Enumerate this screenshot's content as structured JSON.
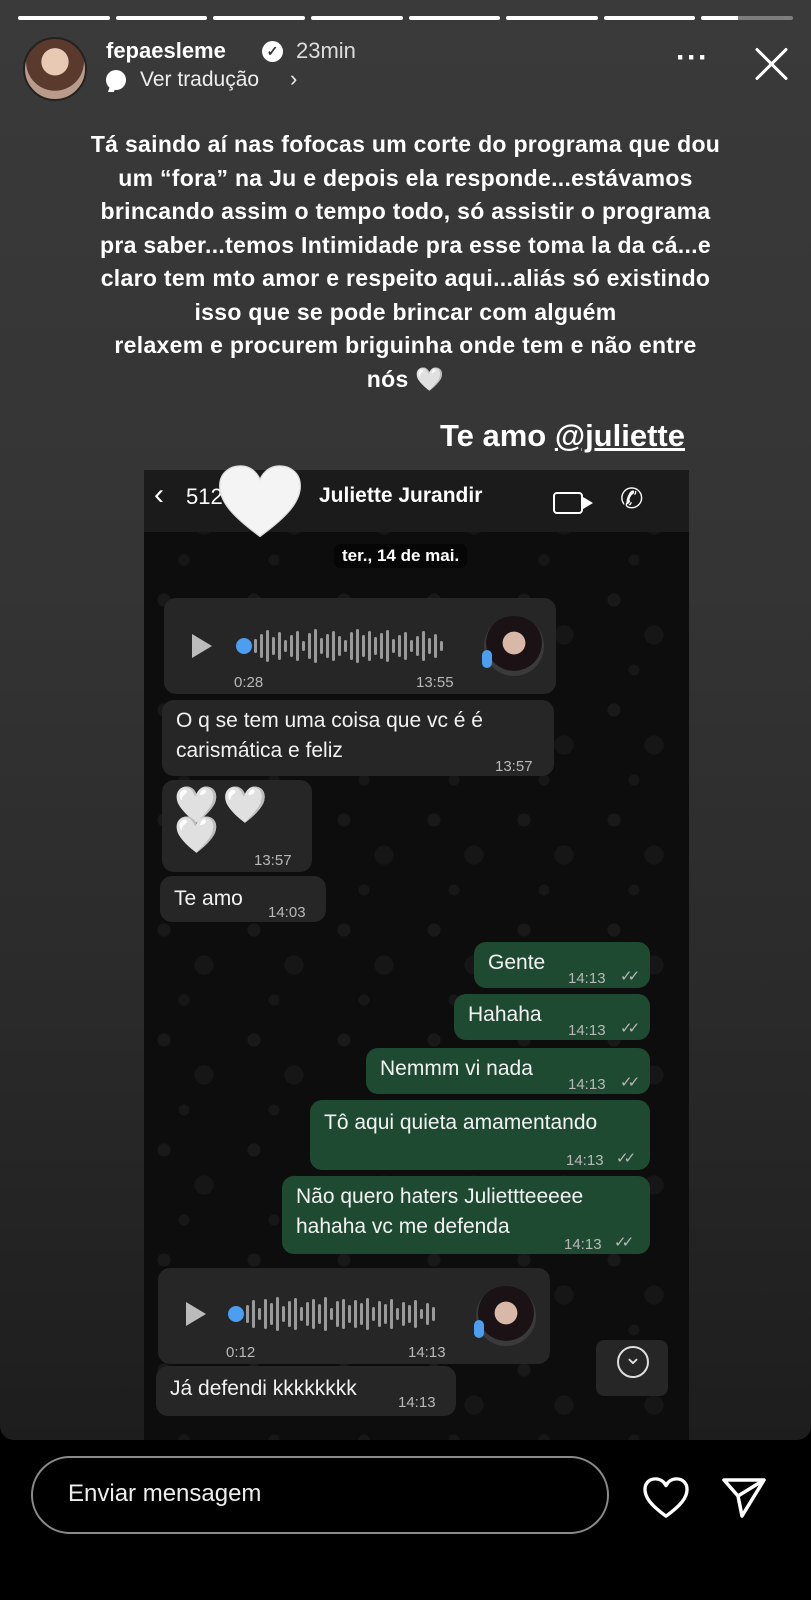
{
  "story": {
    "progress": [
      1,
      1,
      1,
      1,
      1,
      1,
      1,
      0.4
    ],
    "username": "fepaesleme",
    "time_ago": "23min",
    "translate_label": "Ver tradução",
    "caption_lines": [
      "Tá saindo aí nas fofocas um corte do programa que dou",
      "um “fora” na Ju e depois ela responde...estávamos",
      "brincando assim o tempo todo, só assistir o programa",
      "pra saber...temos Intimidade pra esse toma la da cá...e",
      "claro tem mto amor e respeito aqui...aliás só existindo",
      "isso que se pode brincar com alguém",
      "relaxem e procurem briguinha onde tem e não entre",
      "nós 🤍"
    ],
    "sticker_prefix": "Te amo ",
    "sticker_mention": "@juliette"
  },
  "chat": {
    "back_count": "512",
    "contact_name": "Juliette Jurandir",
    "date_chip": "ter., 14 de mai.",
    "voice1": {
      "duration": "0:28",
      "time": "13:55"
    },
    "msg1": {
      "text_lines": [
        "O q se tem uma coisa que vc é é",
        "carismática e feliz"
      ],
      "time": "13:57"
    },
    "msg2": {
      "text": "🤍🤍🤍",
      "time": "13:57"
    },
    "msg3": {
      "text": "Te amo",
      "time": "14:03"
    },
    "out": [
      {
        "text": "Gente",
        "time": "14:13"
      },
      {
        "text": "Hahaha",
        "time": "14:13"
      },
      {
        "text": "Nemmm vi nada",
        "time": "14:13"
      },
      {
        "text": "Tô aqui quieta amamentando",
        "time": "14:13"
      },
      {
        "text_lines": [
          "Não quero haters Juliettteeeee",
          "hahaha vc me defenda"
        ],
        "time": "14:13"
      }
    ],
    "voice2": {
      "duration": "0:12",
      "time": "14:13"
    },
    "msg4": {
      "text": "Já defendi kkkkkkkk",
      "time": "14:13"
    }
  },
  "reply": {
    "placeholder": "Enviar mensagem"
  },
  "icons": {
    "verified": "verified-badge-icon",
    "translate": "speech-bubble-icon",
    "more": "more-options-icon",
    "close": "close-icon",
    "like": "heart-icon",
    "send": "paper-plane-icon"
  }
}
